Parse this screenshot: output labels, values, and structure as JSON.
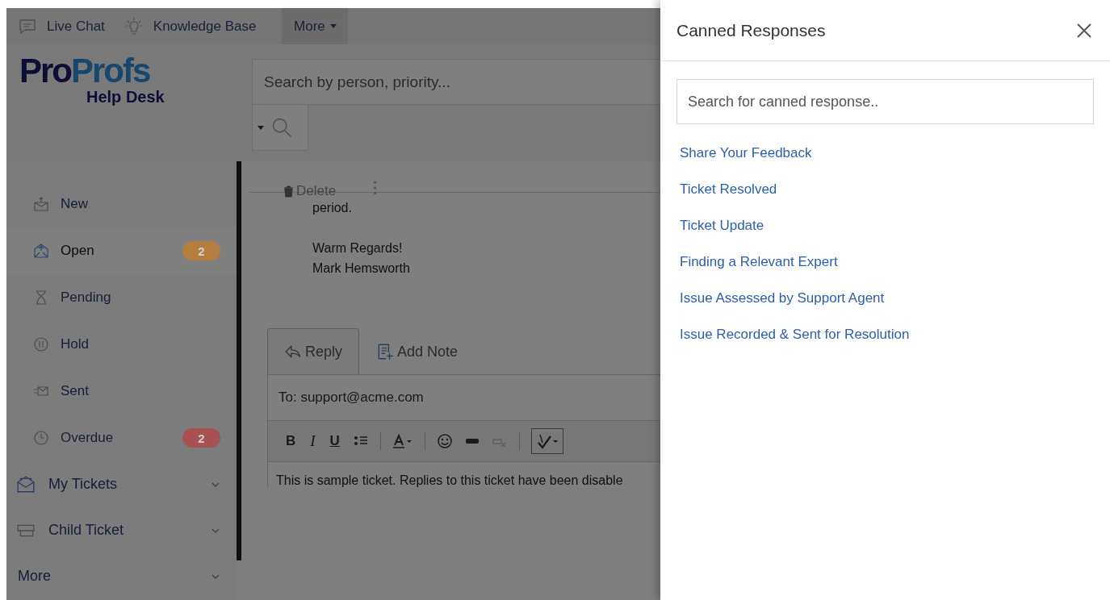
{
  "top_bar": {
    "links": [
      {
        "label": "Live Chat",
        "kind": "chat"
      },
      {
        "label": "Knowledge Base",
        "kind": "bulb"
      }
    ],
    "more_menu": {
      "label": "More"
    }
  },
  "logo": {
    "part_1": "Pro",
    "part_2": "Profs",
    "subtitle": "Help Desk"
  },
  "search": {
    "placeholder": "Search by person, priority..."
  },
  "sidebar": {
    "status_items": [
      {
        "label": "New",
        "kind": "new",
        "selected": false
      },
      {
        "label": "Open",
        "kind": "open",
        "selected": true,
        "badge": "2",
        "color": "#b57e3f"
      },
      {
        "label": "Pending",
        "kind": "pending",
        "selected": false
      },
      {
        "label": "Hold",
        "kind": "hold",
        "selected": false
      },
      {
        "label": "Sent",
        "kind": "sent",
        "selected": false
      },
      {
        "label": "Overdue",
        "kind": "overdue",
        "selected": false,
        "badge": "2",
        "color": "#a85252"
      }
    ],
    "groups": [
      {
        "label": "My Tickets",
        "kind": "tickets",
        "expanded": false
      },
      {
        "label": "Child Ticket",
        "kind": "child",
        "expanded": false
      },
      {
        "label": "More",
        "kind": "plain",
        "expanded": false
      }
    ]
  },
  "ticket": {
    "delete_action": "Delete",
    "message_lines": [
      "period."
    ],
    "signature_lines": [
      "Warm Regards!",
      "Mark Hemsworth"
    ]
  },
  "reply": {
    "tabs": [
      {
        "label": "Reply",
        "kind": "reply",
        "selected": true
      },
      {
        "label": "Add Note",
        "kind": "note",
        "selected": false
      }
    ],
    "to_field": "To: support@acme.com",
    "format_buttons": [
      {
        "label": "B",
        "kind": "bold"
      },
      {
        "label": "I",
        "kind": "italic"
      },
      {
        "label": "U",
        "kind": "underline"
      }
    ],
    "body": "This is sample ticket. Replies to this ticket have been disable"
  },
  "canned_panel": {
    "title": "Canned Responses",
    "search": {
      "placeholder": "Search for canned response.."
    },
    "responses": [
      "Share Your Feedback",
      "Ticket Resolved",
      "Ticket Update",
      "Finding a Relevant Expert",
      "Issue Assessed by Support Agent",
      "Issue Recorded & Sent for Resolution"
    ]
  }
}
